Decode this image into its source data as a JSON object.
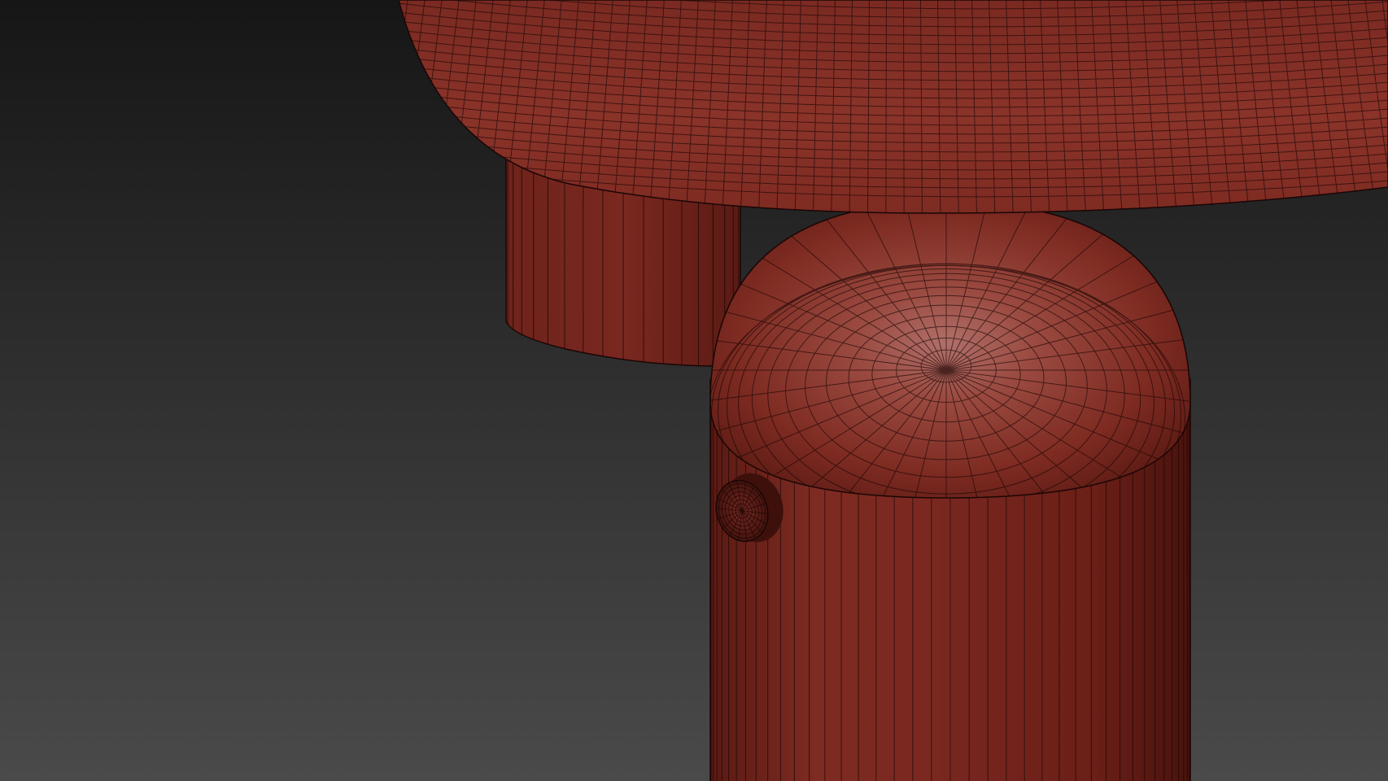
{
  "scene": {
    "background": {
      "top": "#161616",
      "bottom": "#4a4a4a"
    },
    "material": {
      "base": "#7e2b22",
      "highlight": "#b0706a",
      "shadow": "#4a120d",
      "wire": "#1a0605"
    },
    "objects": [
      {
        "name": "lamp-shade",
        "type": "hemisphere"
      },
      {
        "name": "shade-collar",
        "type": "cylinder"
      },
      {
        "name": "lamp-body",
        "type": "capsule"
      },
      {
        "name": "control-knob",
        "type": "cylinder"
      }
    ]
  }
}
